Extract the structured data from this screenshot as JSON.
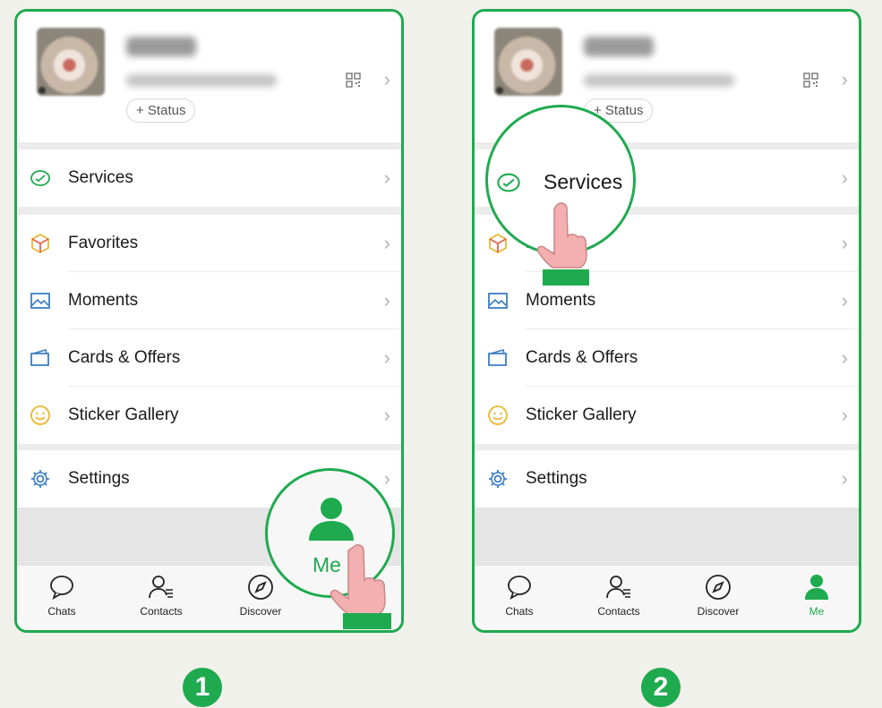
{
  "steps": [
    "1",
    "2"
  ],
  "profile": {
    "status_label": "+ Status"
  },
  "menu": {
    "services": "Services",
    "favorites": "Favorites",
    "moments": "Moments",
    "cards": "Cards & Offers",
    "stickers": "Sticker Gallery",
    "settings": "Settings"
  },
  "tabs": {
    "chats": "Chats",
    "contacts": "Contacts",
    "discover": "Discover",
    "me": "Me"
  },
  "callouts": {
    "me_zoom": "Me",
    "services_zoom": "Services"
  },
  "colors": {
    "accent": "#1faa4f",
    "finger": "#f4b0b0"
  },
  "icons": [
    "qr-code-icon",
    "chevron-right-icon",
    "services-icon",
    "favorites-icon",
    "moments-icon",
    "cards-icon",
    "sticker-icon",
    "settings-icon",
    "chats-icon",
    "contacts-icon",
    "discover-icon",
    "me-icon",
    "tap-finger-icon"
  ]
}
